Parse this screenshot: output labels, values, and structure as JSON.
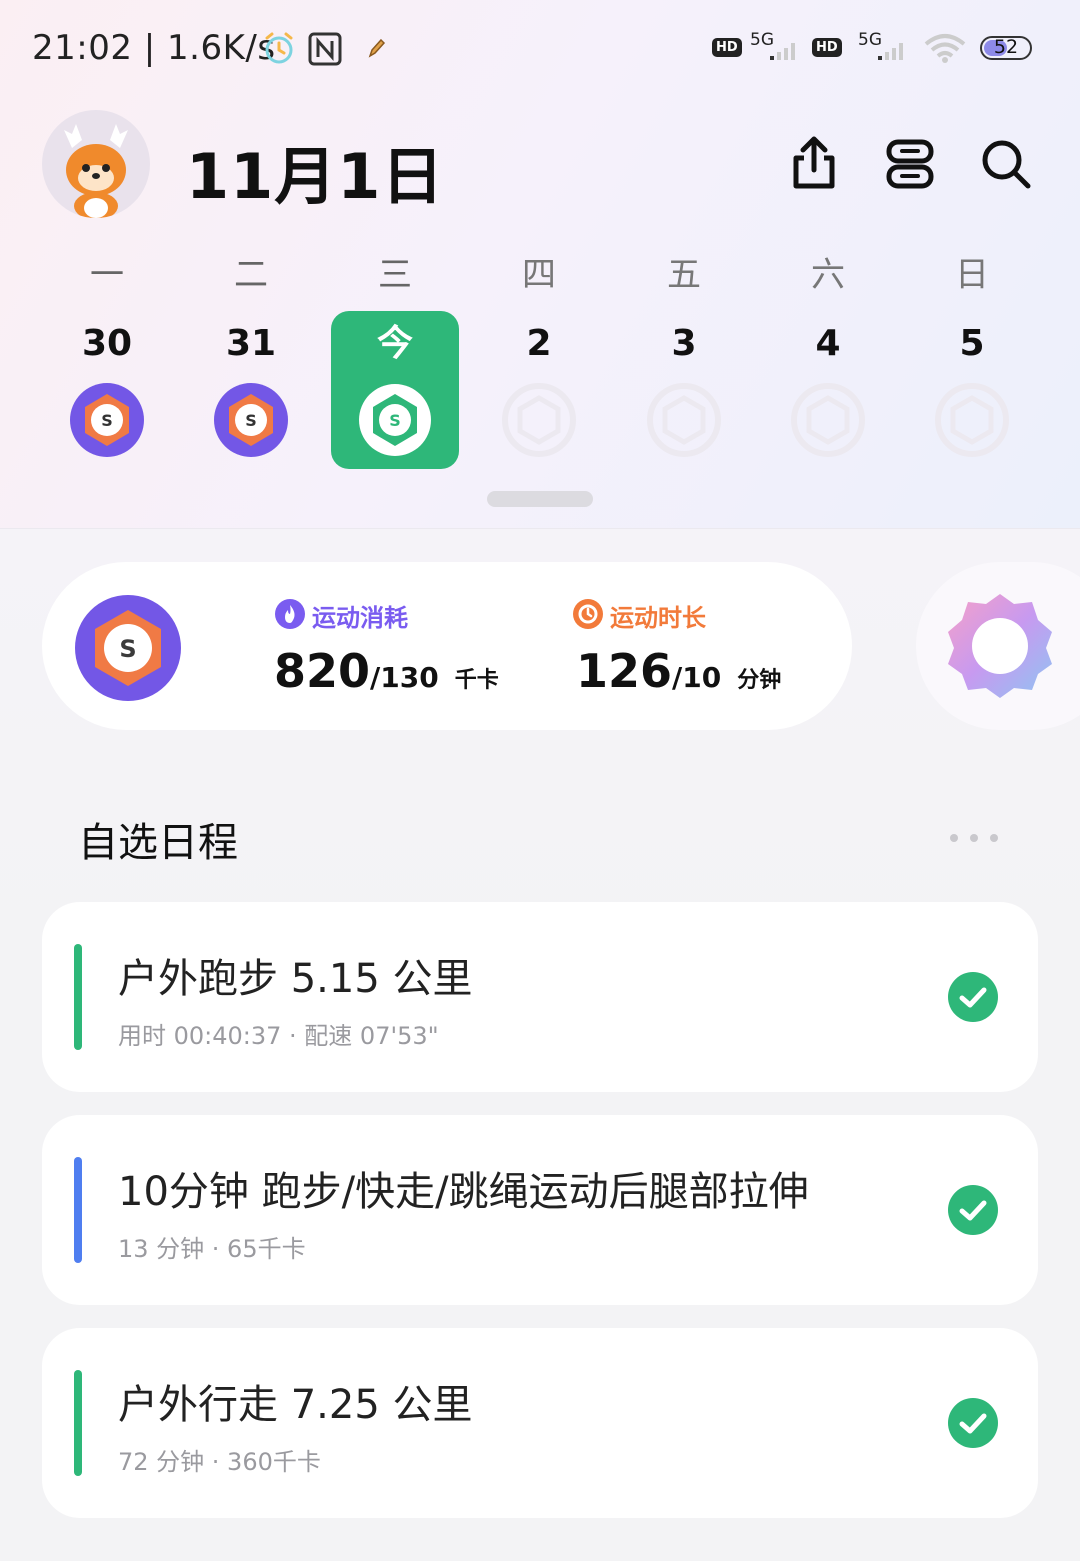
{
  "status_bar": {
    "time_speed": "21:02 | 1.6K/s",
    "network_1": "5G",
    "network_2": "5G",
    "hd_label": "HD",
    "battery": "52",
    "battery_level": 0.52
  },
  "header": {
    "date_title": "11月1日"
  },
  "week": {
    "days": [
      {
        "weekday": "一",
        "date": "30",
        "state": "done"
      },
      {
        "weekday": "二",
        "date": "31",
        "state": "done"
      },
      {
        "weekday": "三",
        "date": "今",
        "state": "today"
      },
      {
        "weekday": "四",
        "date": "2",
        "state": "future"
      },
      {
        "weekday": "五",
        "date": "3",
        "state": "future"
      },
      {
        "weekday": "六",
        "date": "4",
        "state": "future"
      },
      {
        "weekday": "日",
        "date": "5",
        "state": "future"
      }
    ]
  },
  "summary": {
    "calories_label": "运动消耗",
    "calories_value": "820",
    "calories_goal": "/130",
    "calories_unit": "千卡",
    "duration_label": "运动时长",
    "duration_value": "126",
    "duration_goal": "/10",
    "duration_unit": "分钟"
  },
  "schedule": {
    "title": "自选日程",
    "items": [
      {
        "title": "户外跑步 5.15 公里",
        "subtitle": "用时 00:40:37 · 配速 07'53\"",
        "bar_color": "#2eb779",
        "done": true
      },
      {
        "title": "10分钟 跑步/快走/跳绳运动后腿部拉伸",
        "subtitle": "13 分钟 · 65千卡",
        "bar_color": "#4f7ef0",
        "done": true
      },
      {
        "title": "户外行走 7.25 公里",
        "subtitle": "72 分钟 · 360千卡",
        "bar_color": "#2eb779",
        "done": true
      }
    ]
  },
  "colors": {
    "accent_green": "#2eb779",
    "calorie_purple": "#7a5cf0",
    "duration_orange": "#f27a3a",
    "badge_purple": "#7357e6",
    "badge_orange": "#f07a45"
  }
}
